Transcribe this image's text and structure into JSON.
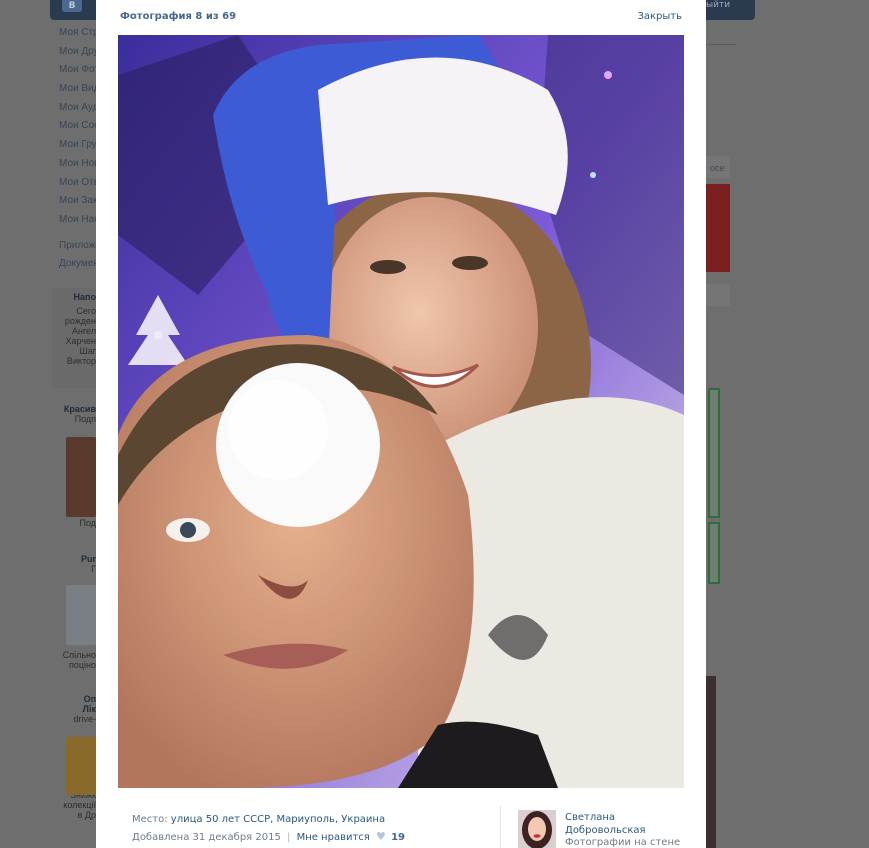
{
  "viewer": {
    "title": "Фотография 8 из 69",
    "close_label": "Закрыть"
  },
  "photo_info": {
    "place_label": "Место:",
    "place_value": "улица 50 лет СССР, Мариуполь, Украина",
    "added": "Добавлена 31 декабря 2015",
    "separator": "|",
    "like_label": "Мне нравится",
    "like_icon": "heart-icon",
    "like_count": "19"
  },
  "owner": {
    "name": "Светлана Добровольская",
    "album_link": "Фотографии на стене"
  },
  "background": {
    "logo": "В",
    "logout": "ыйти",
    "left_menu": [
      "Моя Стр",
      "Мои Дру",
      "Мои Фот",
      "Мои Вид",
      "Мои Ауд",
      "Мои Соо",
      "Мои Гру",
      "Мои Нов",
      "Мои Отв",
      "Мои Зак",
      "Мои Нас"
    ],
    "left_extra": [
      "Приложе",
      "Докумен"
    ],
    "reminder_title": "Напо",
    "reminder_lines": [
      "Сего",
      "рожден",
      "Ангел",
      "Харчен",
      "Шаг",
      "Виктор"
    ],
    "ad1_title": "Красив",
    "ad1_sub": "Подп",
    "ad1_caption": "Под",
    "ad2_title": "Pur",
    "ad2_sub": "Г",
    "ad2_lines": [
      "Спільно",
      "поціно"
    ],
    "ad3_title": "Оп",
    "ad3_title2": "Лік",
    "ad3_sub": "drive-",
    "ad3_lines": [
      "Знижк",
      "колекції",
      "в Др"
    ],
    "right_text": "осе"
  },
  "colors": {
    "link": "#2b587a",
    "title": "#45688e",
    "overlay": "#6e6e6e"
  }
}
